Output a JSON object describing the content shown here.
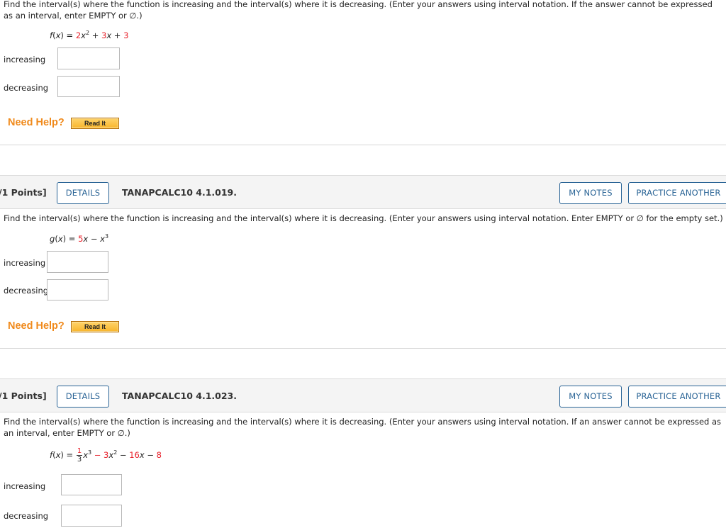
{
  "question1": {
    "prompt": "Find the interval(s) where the function is increasing and the interval(s) where it is decreasing. (Enter your answers using interval notation. If the answer cannot be expressed as an interval, enter EMPTY or ∅.)",
    "formula": {
      "lhs": "f(x)",
      "eq": " = ",
      "terms": [
        {
          "text": "2",
          "color": "red"
        },
        {
          "text": "x",
          "italic": true
        },
        {
          "text": "2",
          "sup": true
        },
        {
          "text": " + "
        },
        {
          "text": "3",
          "color": "red"
        },
        {
          "text": "x",
          "italic": true
        },
        {
          "text": " + "
        },
        {
          "text": "3",
          "color": "red"
        }
      ]
    },
    "increasing_label": "increasing",
    "decreasing_label": "decreasing",
    "increasing_value": "",
    "decreasing_value": "",
    "need_help": "Need Help?",
    "read_it": "Read It"
  },
  "question2": {
    "points": "/1 Points]",
    "details": "DETAILS",
    "id": "TANAPCALC10 4.1.019.",
    "my_notes": "MY NOTES",
    "practice_another": "PRACTICE ANOTHER",
    "prompt": "Find the interval(s) where the function is increasing and the interval(s) where it is decreasing. (Enter your answers using interval notation. Enter EMPTY or ∅ for the empty set.)",
    "increasing_label": "increasing",
    "decreasing_label": "decreasing",
    "increasing_value": "",
    "decreasing_value": "",
    "need_help": "Need Help?",
    "read_it": "Read It"
  },
  "question3": {
    "points": "/1 Points]",
    "details": "DETAILS",
    "id": "TANAPCALC10 4.1.023.",
    "my_notes": "MY NOTES",
    "practice_another": "PRACTICE ANOTHER",
    "prompt": "Find the interval(s) where the function is increasing and the interval(s) where it is decreasing. (Enter your answers using interval notation. If an answer cannot be expressed as an interval, enter EMPTY or ∅.)",
    "frac_num": "1",
    "frac_den": "3",
    "increasing_label": "increasing",
    "decreasing_label": "decreasing",
    "increasing_value": "",
    "decreasing_value": ""
  },
  "colors": {
    "accent": "#2a6496",
    "need_help": "#f08a1c",
    "formula_red": "#e8212b",
    "header_bg": "#f4f4f4"
  }
}
